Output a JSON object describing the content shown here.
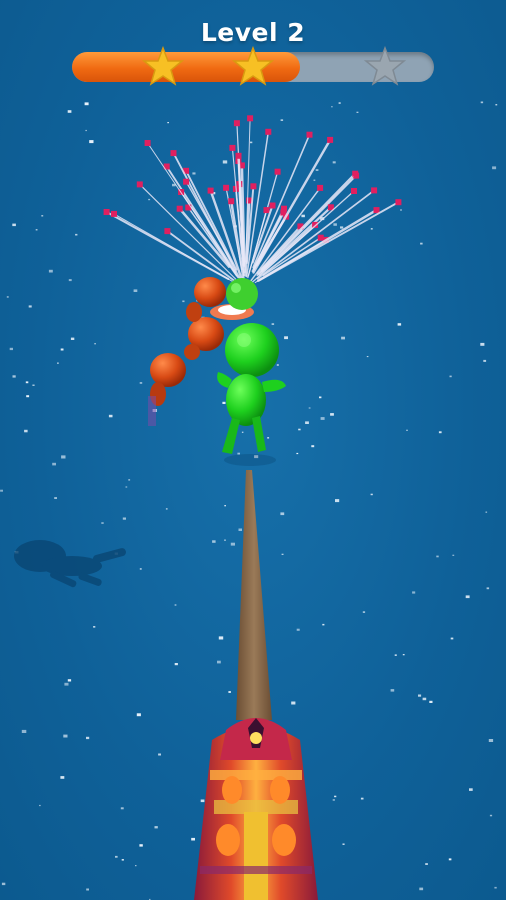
{
  "hud": {
    "level_label": "Level 2",
    "progress_fraction": 0.63,
    "stars": [
      {
        "name": "star-1",
        "earned": true
      },
      {
        "name": "star-2",
        "earned": true
      },
      {
        "name": "star-3",
        "earned": false
      }
    ]
  },
  "colors": {
    "sea": "#0f6199",
    "progress_fill": "#f06a12",
    "progress_track": "#8fa3b4",
    "star_earned": "#f7c024",
    "star_empty": "#9aa6b0",
    "player": "#1ed01e",
    "enemy": "#d84a14",
    "enemy_green": "#3fcf2f",
    "rope": "#8a6a4a",
    "cannon": "#d4342a",
    "spark": "#e8e8f8",
    "spark_tip": "#e02060"
  },
  "icons": {
    "player": "green-stickman-icon",
    "enemy": "orange-stickman-icon",
    "cannon": "cannon-icon",
    "star": "star-icon",
    "shadow": "stickman-shadow-icon"
  }
}
